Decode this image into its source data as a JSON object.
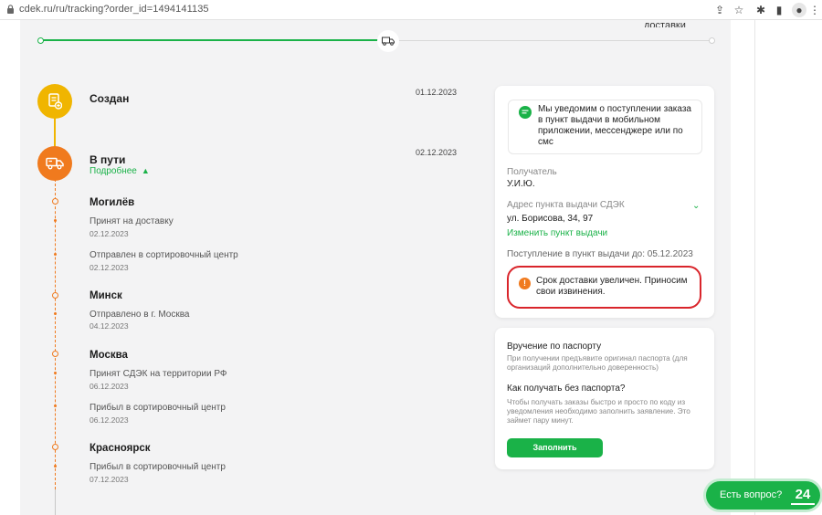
{
  "browser": {
    "url": "cdek.ru/ru/tracking?order_id=1494141135",
    "icons": [
      "share-icon",
      "star-icon",
      "puzzle-icon",
      "sidebar-icon",
      "profile-icon",
      "menu-icon"
    ]
  },
  "progress": {
    "fraction": 0.52,
    "top_cut_text": "доставки"
  },
  "timeline": {
    "stages": [
      {
        "title": "Создан",
        "date": "01.12.2023",
        "icon": "document-icon",
        "color": "#f0b500"
      },
      {
        "title": "В пути",
        "date": "02.12.2023",
        "icon": "truck-icon",
        "color": "#f07a1e",
        "more_label": "Подробнее"
      }
    ],
    "cities": [
      {
        "name": "Могилёв",
        "events": [
          {
            "text": "Принят на доставку",
            "date": "02.12.2023"
          },
          {
            "text": "Отправлен в сортировочный центр",
            "date": "02.12.2023"
          }
        ]
      },
      {
        "name": "Минск",
        "events": [
          {
            "text": "Отправлено в г. Москва",
            "date": "04.12.2023"
          }
        ]
      },
      {
        "name": "Москва",
        "events": [
          {
            "text": "Принят СДЭК на территории РФ",
            "date": "06.12.2023"
          },
          {
            "text": "Прибыл в сортировочный центр",
            "date": "06.12.2023"
          }
        ]
      },
      {
        "name": "Красноярск",
        "events": [
          {
            "text": "Прибыл в сортировочный центр",
            "date": "07.12.2023"
          }
        ]
      }
    ]
  },
  "info_card": {
    "notice": "Мы уведомим о поступлении заказа в пункт выдачи в мобильном приложении, мессенджере или по смс",
    "recipient_label": "Получатель",
    "recipient_value": "У.И.Ю.",
    "address_label": "Адрес пункта выдачи СДЭК",
    "address_value": "ул. Борисова, 34, 97",
    "change_link": "Изменить пункт выдачи",
    "arrival": "Поступление в пункт выдачи до: 05.12.2023",
    "warning": "Срок доставки увеличен. Приносим свои извинения.",
    "accent": "#1ab248",
    "warning_color": "#f07a1e",
    "highlight_color": "#d9252b"
  },
  "passport_card": {
    "title1": "Вручение по паспорту",
    "desc1": "При получении предъявите оригинал паспорта (для организаций дополнительно доверенность)",
    "title2": "Как получать без паспорта?",
    "desc2": "Чтобы получать заказы быстро и просто по коду из уведомления необходимо заполнить заявление. Это займет пару минут.",
    "button": "Заполнить"
  },
  "chat": {
    "label": "Есть вопрос?",
    "logo": "24"
  }
}
